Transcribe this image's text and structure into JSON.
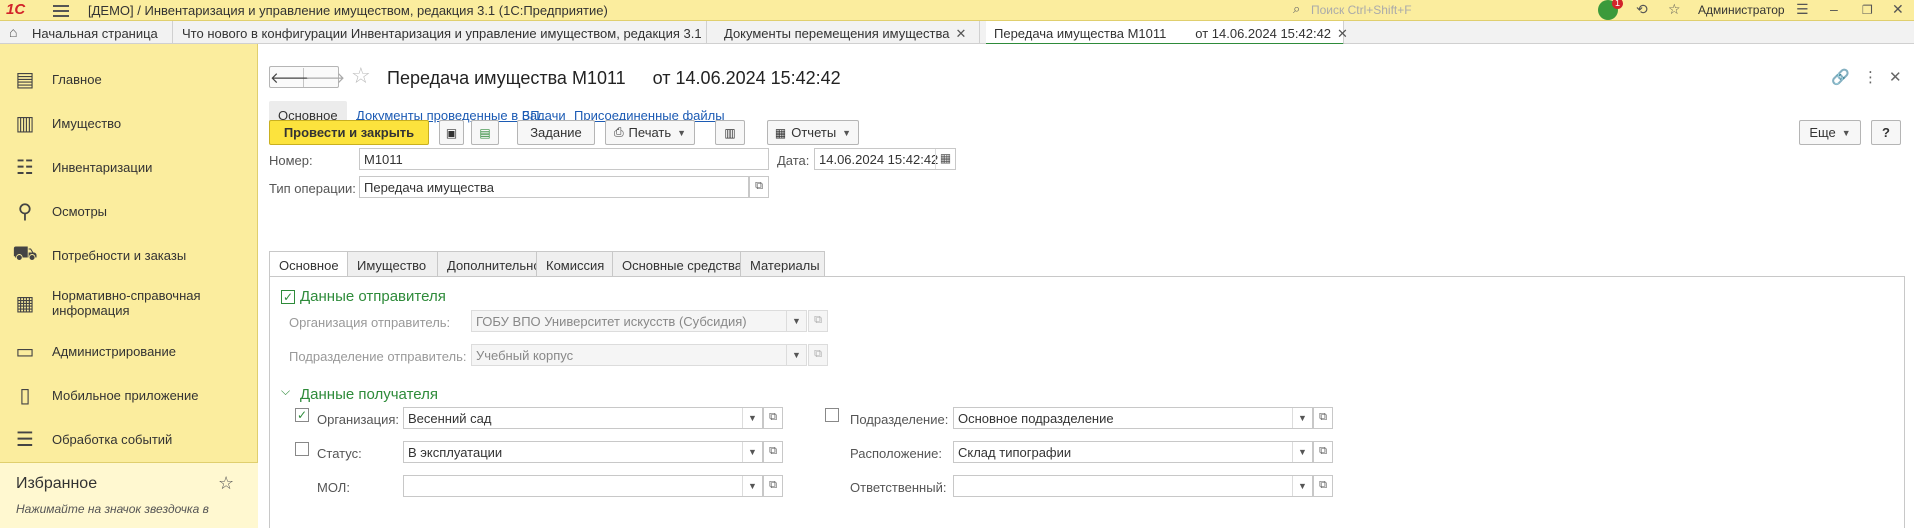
{
  "app": {
    "logo": "1С",
    "title": "[ДЕМО] / Инвентаризация и управление имуществом, редакция 3.1  (1С:Предприятие)",
    "search_placeholder": "Поиск Ctrl+Shift+F",
    "notifications_count": "1",
    "user": "Администратор"
  },
  "window_tabs": [
    {
      "label": "Начальная страница"
    },
    {
      "label": "Что нового в конфигурации Инвентаризация и управление имуществом, редакция 3.1"
    },
    {
      "label": "Документы перемещения имущества"
    },
    {
      "label": "Передача имущества М1011        от 14.06.2024 15:42:42"
    }
  ],
  "sidebar": {
    "items": [
      {
        "label": "Главное",
        "icon": "document-list-icon"
      },
      {
        "label": "Имущество",
        "icon": "book-icon"
      },
      {
        "label": "Инвентаризации",
        "icon": "checklist-icon"
      },
      {
        "label": "Осмотры",
        "icon": "magnifier-icon"
      },
      {
        "label": "Потребности и заказы",
        "icon": "cart-icon"
      },
      {
        "label": "Нормативно-справочная информация",
        "icon": "reference-book-icon"
      },
      {
        "label": "Администрирование",
        "icon": "monitor-icon"
      },
      {
        "label": "Мобильное приложение",
        "icon": "mobile-icon"
      },
      {
        "label": "Обработка событий",
        "icon": "events-icon"
      }
    ],
    "favorites_title": "Избранное",
    "favorites_hint": "Нажимайте на значок звездочка в"
  },
  "document": {
    "title": "Передача имущества М1011",
    "date_title": "от 14.06.2024 15:42:42",
    "subtabs": {
      "main": "Основное",
      "bp_docs": "Документы проведенные в БП",
      "tasks": "Задачи",
      "files": "Присоединенные файлы"
    },
    "toolbar": {
      "post_close": "Провести и закрыть",
      "task": "Задание",
      "print": "Печать",
      "reports": "Отчеты",
      "more": "Еще",
      "help": "?"
    },
    "fields": {
      "number_label": "Номер:",
      "number_value": "М1011",
      "date_label": "Дата:",
      "date_value": "14.06.2024 15:42:42",
      "optype_label": "Тип операции:",
      "optype_value": "Передача имущества"
    },
    "form_tabs": [
      "Основное",
      "Имущество",
      "Дополнительно",
      "Комиссия",
      "Основные средства",
      "Материалы"
    ],
    "sender": {
      "title": "Данные отправителя",
      "org_label": "Организация отправитель:",
      "org_value": "ГОБУ ВПО Университет искусств (Субсидия)",
      "dept_label": "Подразделение отправитель:",
      "dept_value": "Учебный корпус"
    },
    "recipient": {
      "title": "Данные получателя",
      "org_label": "Организация:",
      "org_value": "Весенний сад",
      "org_checked": true,
      "status_label": "Статус:",
      "status_value": "В эксплуатации",
      "status_checked": false,
      "mol_label": "МОЛ:",
      "mol_value": "",
      "dept_label": "Подразделение:",
      "dept_value": "Основное подразделение",
      "dept_checked": false,
      "location_label": "Расположение:",
      "location_value": "Склад типографии",
      "responsible_label": "Ответственный:",
      "responsible_value": ""
    }
  }
}
